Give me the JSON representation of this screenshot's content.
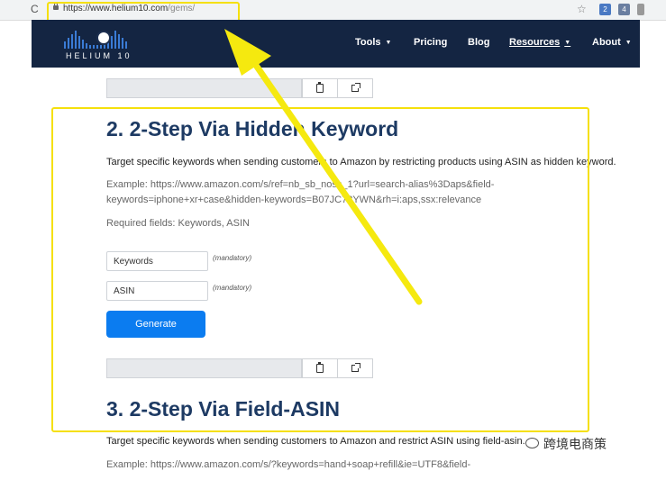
{
  "browser": {
    "url_host": "https://www.helium10.com",
    "url_path": "/gems/",
    "reload_icon": "reload-icon",
    "star_icon": "star-icon",
    "extensions": [
      {
        "name": "extension-icon",
        "badge": "2"
      },
      {
        "name": "extension-icon",
        "badge": "4"
      }
    ]
  },
  "header": {
    "logo_text": "HELIUM 10",
    "nav": {
      "tools": "Tools",
      "pricing": "Pricing",
      "blog": "Blog",
      "resources": "Resources",
      "about": "About"
    }
  },
  "section2": {
    "title": "2. 2-Step Via Hidden Keyword",
    "description": "Target specific keywords when sending customers to Amazon by restricting products using ASIN as hidden keyword.",
    "example_line1": "Example: https://www.amazon.com/s/ref=nb_sb_noss_1?url=search-alias%3Daps&field-",
    "example_line2": "keywords=iphone+xr+case&hidden-keywords=B07JC78YWN&rh=i:aps,ssx:relevance",
    "required": "Required fields: Keywords, ASIN",
    "keywords_value": "Keywords",
    "asin_value": "ASIN",
    "mandatory_label": "(mandatory)",
    "generate_label": "Generate"
  },
  "section3": {
    "title": "3. 2-Step Via Field-ASIN",
    "description": "Target specific keywords when sending customers to Amazon and restrict ASIN using field-asin.",
    "example": "Example: https://www.amazon.com/s/?keywords=hand+soap+refill&ie=UTF8&field-"
  },
  "watermark": {
    "text": "跨境电商策"
  },
  "colors": {
    "header_bg": "#142542",
    "title": "#1d3a63",
    "generate_button": "#0b7cf0",
    "highlight": "#f5e00c"
  }
}
